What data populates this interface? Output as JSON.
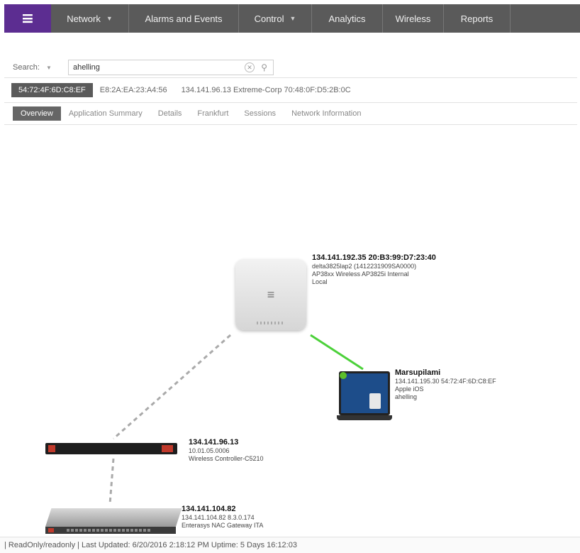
{
  "nav": {
    "items": [
      {
        "label": "Network",
        "has_caret": true
      },
      {
        "label": "Alarms and Events",
        "has_caret": false
      },
      {
        "label": "Control",
        "has_caret": true
      },
      {
        "label": "Analytics",
        "has_caret": false
      },
      {
        "label": "Wireless",
        "has_caret": false
      },
      {
        "label": "Reports",
        "has_caret": false
      }
    ],
    "accent_color": "#5c2d91"
  },
  "search": {
    "label": "Search:",
    "value": "ahelling"
  },
  "addresses": {
    "selected": "54:72:4F:6D:C8:EF",
    "others": [
      "E8:2A:EA:23:A4:56",
      "134.141.96.13 Extreme-Corp 70:48:0F:D5:2B:0C"
    ]
  },
  "tabs": [
    "Overview",
    "Application Summary",
    "Details",
    "Frankfurt",
    "Sessions",
    "Network Information"
  ],
  "topology": {
    "ap": {
      "title": "134.141.192.35 20:B3:99:D7:23:40",
      "lines": [
        "delta3825lap2 (1412231909SA0000)",
        "AP38xx Wireless AP3825i Internal",
        "Local"
      ]
    },
    "client": {
      "title": "Marsupilami",
      "lines": [
        "134.141.195.30 54:72:4F:6D:C8:EF",
        "Apple iOS",
        "ahelling"
      ]
    },
    "controller": {
      "title": "134.141.96.13",
      "lines": [
        "10.01.05.0006",
        "Wireless Controller-C5210"
      ]
    },
    "nac": {
      "title": "134.141.104.82",
      "lines": [
        "134.141.104.82 8.3.0.174",
        "Enterasys NAC Gateway ITA"
      ]
    },
    "link_colors": {
      "wireless": "#4cd13a",
      "wired": "#aaaaaa"
    }
  },
  "status_bar": {
    "text": "| ReadOnly/readonly |  Last Updated: 6/20/2016 2:18:12 PM  Uptime: 5 Days 16:12:03"
  }
}
